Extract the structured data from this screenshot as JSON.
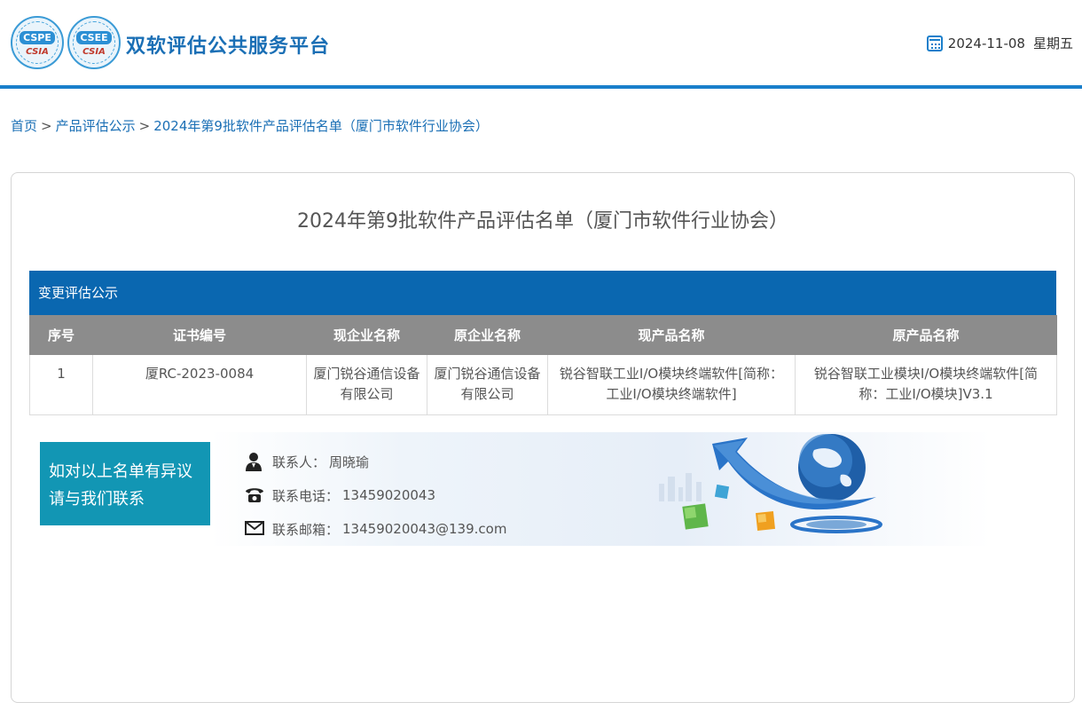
{
  "header": {
    "logos": [
      {
        "code": "CSPE",
        "mark": "CSIA"
      },
      {
        "code": "CSEE",
        "mark": "CSIA"
      }
    ],
    "site_title": "双软评估公共服务平台",
    "date": "2024-11-08",
    "weekday": "星期五"
  },
  "breadcrumb": {
    "home": "首页",
    "section": "产品评估公示",
    "current": "2024年第9批软件产品评估名单（厦门市软件行业协会）",
    "separator": ">"
  },
  "main": {
    "title": "2024年第9批软件产品评估名单（厦门市软件行业协会）",
    "section_label": "变更评估公示",
    "table": {
      "headers": [
        "序号",
        "证书编号",
        "现企业名称",
        "原企业名称",
        "现产品名称",
        "原产品名称"
      ],
      "rows": [
        [
          "1",
          "厦RC-2023-0084",
          "厦门锐谷通信设备有限公司",
          "厦门锐谷通信设备有限公司",
          "锐谷智联工业I/O模块终端软件[简称：工业I/O模块终端软件]",
          "锐谷智联工业模块I/O模块终端软件[简称：工业I/O模块]V3.1"
        ]
      ]
    }
  },
  "contact": {
    "prompt_line1": "如对以上名单有异议",
    "prompt_line2": "请与我们联系",
    "person_label": "联系人：",
    "person": "周晓瑜",
    "phone_label": "联系电话：",
    "phone": "13459020043",
    "email_label": "联系邮箱：",
    "email": "13459020043@139.com"
  },
  "colors": {
    "header_rule": "#1a7fcb",
    "title_blue": "#1a6fb5",
    "section_bar": "#0a67b0",
    "table_header": "#8c8c8c",
    "contact_box": "#1296b4"
  }
}
